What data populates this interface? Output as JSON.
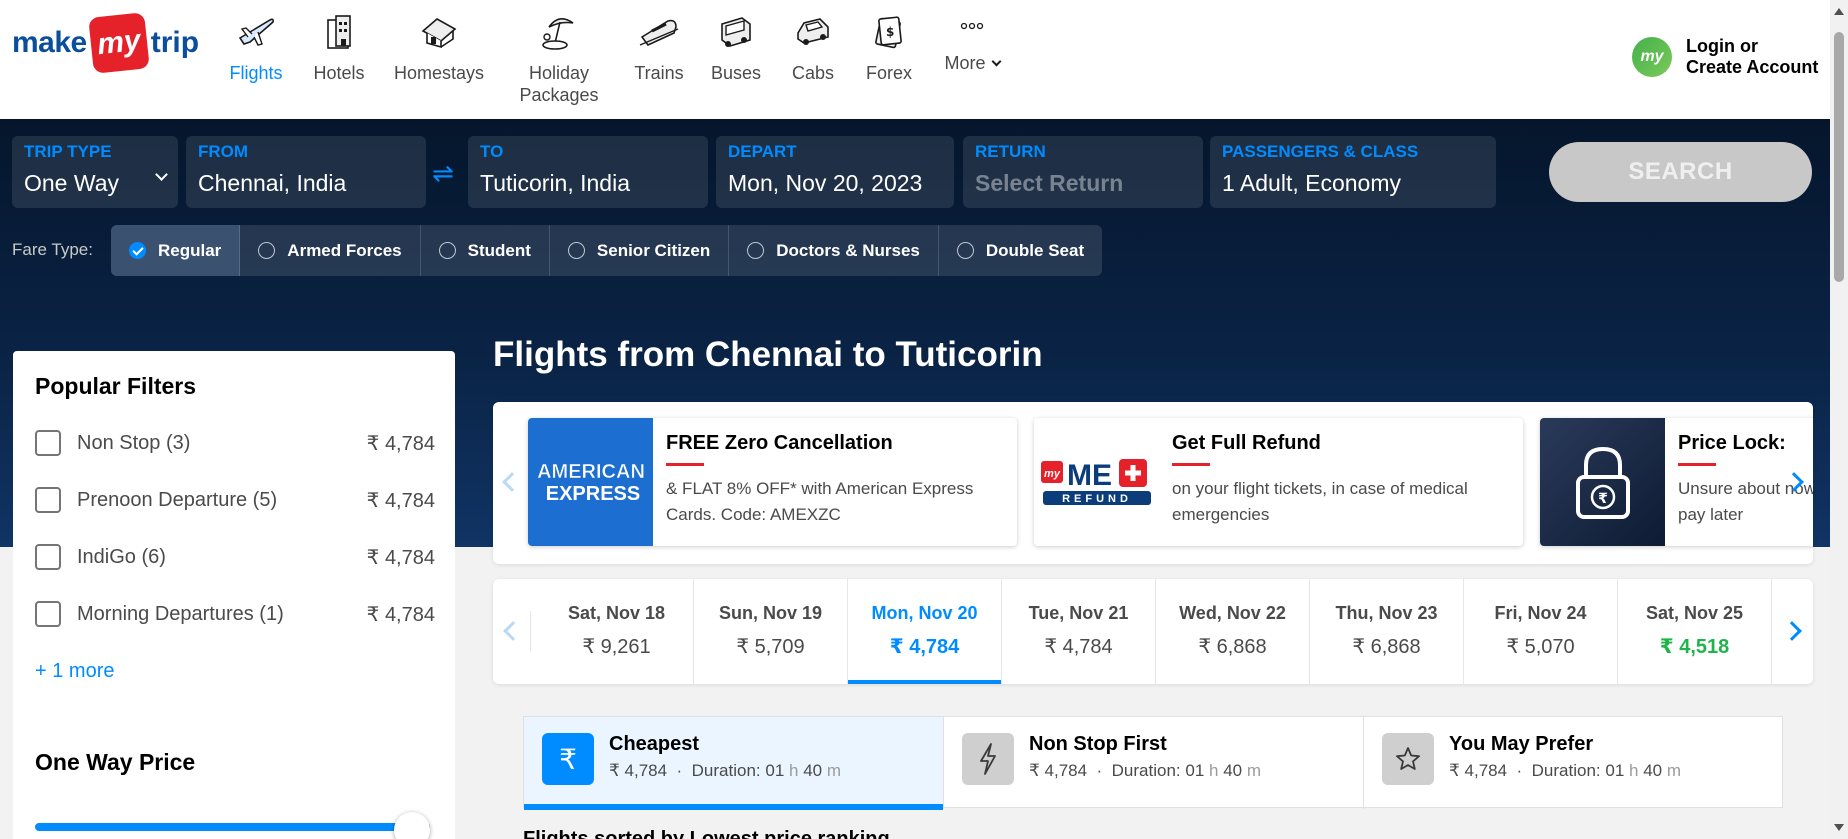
{
  "brand": {
    "make": "make",
    "my": "my",
    "trip": "trip"
  },
  "nav": [
    {
      "label": "Flights",
      "icon": "plane-icon"
    },
    {
      "label": "Hotels",
      "icon": "hotel-icon"
    },
    {
      "label": "Homestays",
      "icon": "homestay-icon"
    },
    {
      "label": "Holiday Packages",
      "icon": "holiday-icon"
    },
    {
      "label": "Trains",
      "icon": "train-icon"
    },
    {
      "label": "Buses",
      "icon": "bus-icon"
    },
    {
      "label": "Cabs",
      "icon": "cab-icon"
    },
    {
      "label": "Forex",
      "icon": "forex-icon"
    },
    {
      "label": "More",
      "icon": "more-icon"
    }
  ],
  "login": {
    "avatar": "my",
    "line1": "Login or",
    "line2": "Create Account"
  },
  "search": {
    "trip_type": {
      "label": "TRIP TYPE",
      "value": "One Way"
    },
    "from": {
      "label": "FROM",
      "value": "Chennai, India"
    },
    "to": {
      "label": "TO",
      "value": "Tuticorin, India"
    },
    "depart": {
      "label": "DEPART",
      "value": "Mon, Nov 20, 2023"
    },
    "return": {
      "label": "RETURN",
      "placeholder": "Select Return"
    },
    "passengers": {
      "label": "PASSENGERS & CLASS",
      "value": "1 Adult, Economy"
    },
    "button": "SEARCH",
    "swap": "⇌"
  },
  "fare": {
    "label": "Fare Type:",
    "options": [
      "Regular",
      "Armed Forces",
      "Student",
      "Senior Citizen",
      "Doctors & Nurses",
      "Double Seat"
    ],
    "selected": "Regular"
  },
  "filters": {
    "title": "Popular Filters",
    "items": [
      {
        "name": "Non Stop (3)",
        "price": "₹ 4,784"
      },
      {
        "name": "Prenoon Departure (5)",
        "price": "₹ 4,784"
      },
      {
        "name": "IndiGo (6)",
        "price": "₹ 4,784"
      },
      {
        "name": "Morning Departures (1)",
        "price": "₹ 4,784"
      }
    ],
    "more": "+ 1 more",
    "price_title": "One Way Price",
    "price_slider_fraction": 1.0
  },
  "main": {
    "title": "Flights from Chennai to Tuticorin",
    "offers": [
      {
        "title": "FREE Zero Cancellation",
        "desc": "& FLAT 8% OFF* with American Express Cards. Code: AMEXZC",
        "logo_text": "AMERICAN EXPRESS"
      },
      {
        "title": "Get Full Refund",
        "desc": "on your flight tickets, in case of medical emergencies",
        "logo_text": "my ME+ REFUND"
      },
      {
        "title": "Price Lock:",
        "desc": "Unsure about now, pay later"
      }
    ],
    "dates": [
      {
        "day": "Sat, Nov 18",
        "price": "₹ 9,261"
      },
      {
        "day": "Sun, Nov 19",
        "price": "₹ 5,709"
      },
      {
        "day": "Mon, Nov 20",
        "price": "₹ 4,784"
      },
      {
        "day": "Tue, Nov 21",
        "price": "₹ 4,784"
      },
      {
        "day": "Wed, Nov 22",
        "price": "₹ 6,868"
      },
      {
        "day": "Thu, Nov 23",
        "price": "₹ 6,868"
      },
      {
        "day": "Fri, Nov 24",
        "price": "₹ 5,070"
      },
      {
        "day": "Sat, Nov 25",
        "price": "₹ 4,518"
      }
    ],
    "selected_date": "Mon, Nov 20",
    "sorts": [
      {
        "title": "Cheapest",
        "price": "₹ 4,784",
        "dur_label": "Duration: 01",
        "h": "h",
        "mins": "40",
        "m": "m"
      },
      {
        "title": "Non Stop First",
        "price": "₹ 4,784",
        "dur_label": "Duration: 01",
        "h": "h",
        "mins": "40",
        "m": "m"
      },
      {
        "title": "You May Prefer",
        "price": "₹ 4,784",
        "dur_label": "Duration: 01",
        "h": "h",
        "mins": "40",
        "m": "m"
      }
    ],
    "list_heading": "Flights sorted by Lowest price ranking"
  },
  "colors": {
    "brand_blue": "#008cff",
    "logo_blue": "#0b4f9c",
    "logo_red": "#e5212a",
    "low_price_green": "#1fb44a",
    "hero_dark": "#05162c"
  }
}
